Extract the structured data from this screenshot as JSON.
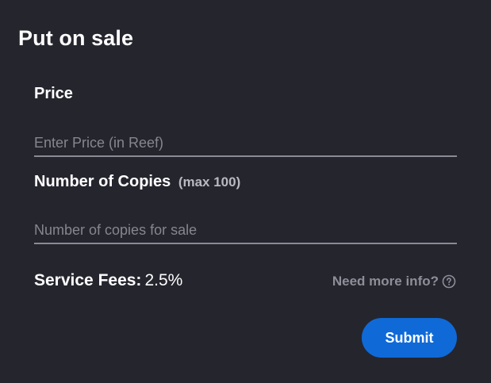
{
  "dialog": {
    "title": "Put on sale"
  },
  "price": {
    "label": "Price",
    "placeholder": "Enter Price (in Reef)",
    "value": ""
  },
  "copies": {
    "label": "Number of Copies",
    "hint": "(max 100)",
    "placeholder": "Number of copies for sale",
    "value": ""
  },
  "fees": {
    "label": "Service Fees:",
    "value": "2.5%"
  },
  "info": {
    "label": "Need more info?",
    "icon": "question-circle-icon"
  },
  "actions": {
    "submit_label": "Submit"
  },
  "colors": {
    "background": "#25252e",
    "accent": "#0f6ad8",
    "muted_text": "#8e8e98"
  }
}
